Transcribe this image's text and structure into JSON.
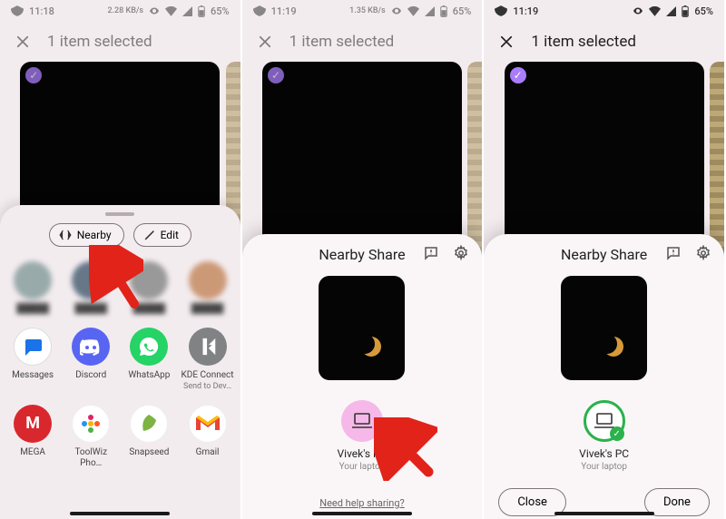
{
  "status": {
    "time1": "11:18",
    "time23": "11:19",
    "net_label1": "2.28 KB/s",
    "net_label23": "1.35 KB/s",
    "battery": "65%"
  },
  "selection_header": {
    "title": "1 item selected"
  },
  "share_sheet": {
    "chip_nearby": "Nearby",
    "chip_edit": "Edit",
    "apps": [
      {
        "name": "Messages",
        "color": "#ffffff",
        "fg": "#1a73e8",
        "icon": "chat-bubble"
      },
      {
        "name": "Discord",
        "color": "#5865F2",
        "fg": "#ffffff",
        "icon": "discord"
      },
      {
        "name": "WhatsApp",
        "color": "#25D366",
        "fg": "#ffffff",
        "icon": "whatsapp"
      },
      {
        "name": "KDE Connect",
        "sub": "Send to Dev…",
        "color": "#808284",
        "fg": "#ffffff",
        "icon": "kde"
      },
      {
        "name": "MEGA",
        "color": "#d9272e",
        "fg": "#ffffff",
        "icon": "mega"
      },
      {
        "name": "ToolWiz Pho…",
        "color": "#ffffff",
        "fg": "#ff7043",
        "icon": "flower"
      },
      {
        "name": "Snapseed",
        "color": "#ffffff",
        "fg": "#7cb342",
        "icon": "leaf"
      },
      {
        "name": "Gmail",
        "color": "#ffffff",
        "fg": "#ea4335",
        "icon": "gmail"
      }
    ]
  },
  "nearby": {
    "title": "Nearby Share",
    "device_name": "Vivek's PC",
    "device_sub": "Your laptop",
    "help_link": "Need help sharing?",
    "close_label": "Close",
    "done_label": "Done"
  }
}
